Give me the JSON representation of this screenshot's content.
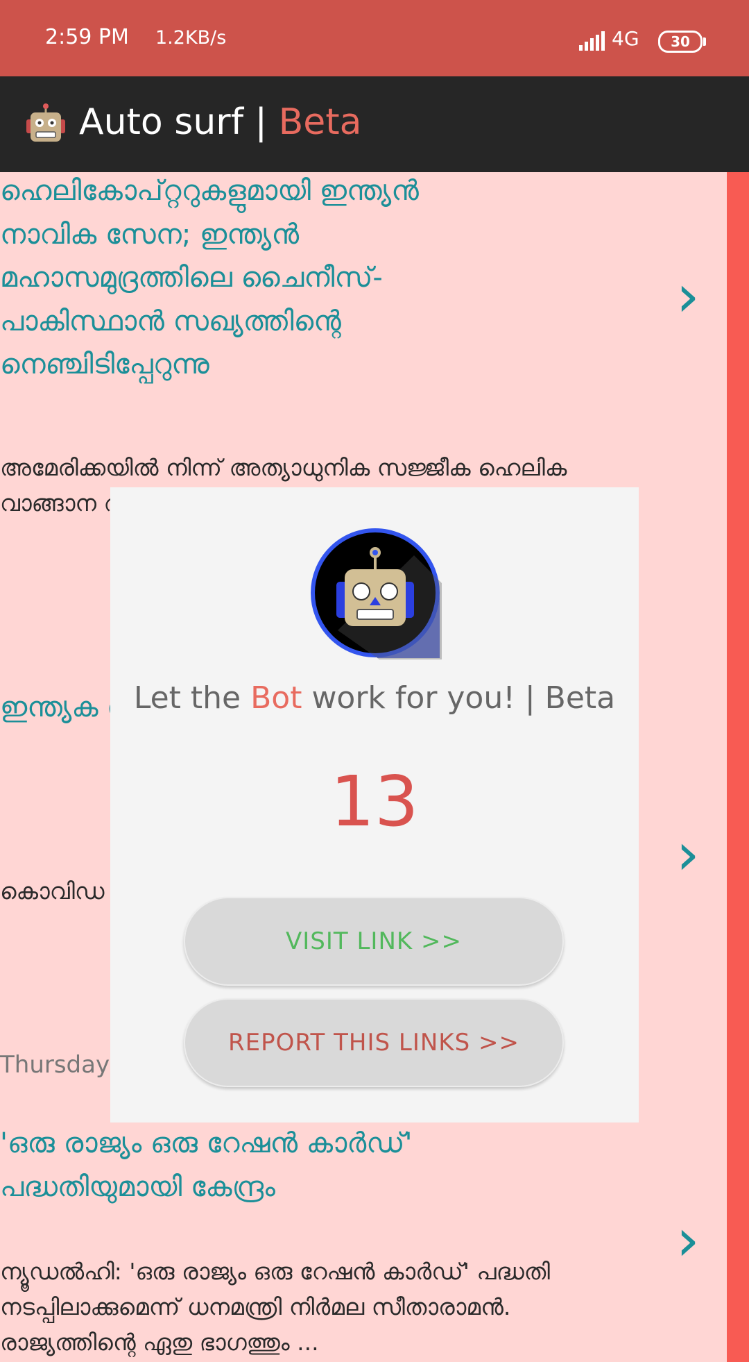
{
  "status_bar": {
    "time": "2:59 PM",
    "speed": "1.2KB/s",
    "network": "4G",
    "battery": "30"
  },
  "app_bar": {
    "title_main": "Auto surf | ",
    "title_accent": "Beta",
    "icon": "robot-icon"
  },
  "articles": [
    {
      "title": "ഹെലികോപ്റ്ററുകളുമായി ഇന്ത്യൻ നാവിക സേന; ഇന്ത്യൻ മഹാസമുദ്രത്തിലെ ചൈനീസ്- പാകിസ്ഥാൻ സഖ്യത്തിന്റെ നെഞ്ചിടിപ്പേറുന്നു",
      "body": "അമേരിക്കയിൽ നിന്ന് അത്യാധുനിക സജ്ജീക ഹെലിക വാങ്ങാന അമേ..."
    },
    {
      "title": "ഇന്ത്യക സഹായ ബാങ്ക്; സാമൂഹ",
      "body": "കൊവിഡ സഹായ സഹായ 7500കോ"
    },
    {
      "title": "'ഒരു രാജ്യം ഒരു റേഷൻ കാർഡ്' പദ്ധതിയുമായി കേന്ദ്രം",
      "body": "ന്യൂഡൽഹി: 'ഒരു രാജ്യം ഒരു റേഷൻ കാർഡ്' പദ്ധതി നടപ്പിലാക്കുമെന്ന് ധനമന്ത്രി നിർമല സീതാരാമൻ. രാജ്യത്തിന്റെ ഏതു ഭാഗത്തും ..."
    }
  ],
  "day_label": "Thursday",
  "dialog": {
    "tagline_pre": "Let the ",
    "tagline_accent": "Bot",
    "tagline_post": " work for you! | Beta",
    "countdown": "13",
    "visit_label": "VISIT LINK >>",
    "report_label": "REPORT THIS LINKS >>"
  },
  "colors": {
    "status_bar": "#cd534b",
    "app_bar": "#262626",
    "background": "#ffd6d4",
    "title_teal": "#1b8f98",
    "accent": "#e86b5f",
    "visit_green": "#52b85c",
    "report_red": "#c0544b"
  }
}
